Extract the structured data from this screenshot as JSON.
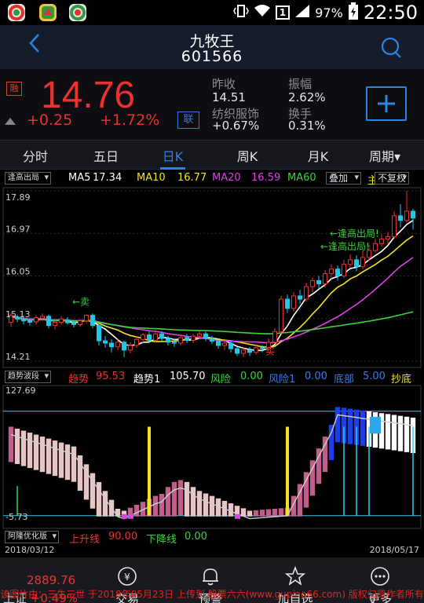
{
  "status_bar": {
    "battery": "97%",
    "time": "22:50",
    "sim": "1"
  },
  "header": {
    "stock_name": "九牧王",
    "stock_code": "601566"
  },
  "quote": {
    "margin_badge": "融",
    "price": "14.76",
    "change": "+0.25",
    "change_pct": "+1.72%",
    "link_badge": "联",
    "prev_close_label": "昨收",
    "prev_close": "14.51",
    "amplitude_label": "振幅",
    "amplitude": "2.62%",
    "sector": "纺织服饰",
    "sector_chg": "+0.67%",
    "turnover_label": "换手",
    "turnover": "0.31%"
  },
  "tabs": [
    "分时",
    "五日",
    "日K",
    "周K",
    "月K",
    "周期▾"
  ],
  "active_tab": 2,
  "kline_bar": {
    "dropdown": "逢高出局",
    "ma5_label": "MA5",
    "ma5": "17.34",
    "ma10_label": "MA10",
    "ma10": "16.77",
    "ma20_label": "MA20",
    "ma20": "16.59",
    "ma60_label": "MA60",
    "overlay_btn": "叠加",
    "adjust_btn": "不复权"
  },
  "osc_bar": {
    "dropdown": "趋势波段",
    "trend_label": "趋势",
    "trend": "95.53",
    "trend1_label": "趋势1",
    "trend1": "105.70",
    "risk_label": "风险",
    "risk": "0.00",
    "risk1_label": "风险1",
    "risk1": "0.00",
    "bottom_label": "底部",
    "bottom": "5.00",
    "catch_label": "抄底"
  },
  "lower_bar": {
    "dropdown": "阿隆优化版",
    "up_label": "上升线",
    "up": "90.00",
    "down_label": "下降线",
    "down": "0.00"
  },
  "dates": {
    "start": "2018/03/12",
    "end": "2018/05/17"
  },
  "bottom_nav": {
    "index_value": "2889.76",
    "index_change": "+0.49%",
    "index_prefix": "上证",
    "items": [
      "交易",
      "预警",
      "加自选",
      "更多"
    ]
  },
  "watermark": "该图片由：三生三世 于2018年05月23日 上传到 股票六六(www.gupiao66.com) 版权归原作者所有",
  "chart_data": [
    {
      "type": "candlestick",
      "title": "日K",
      "ylim": [
        14.21,
        17.89
      ],
      "ticks": [
        "17.89",
        "16.97",
        "16.05",
        "15.13",
        "14.21"
      ],
      "annotations": [
        "←卖",
        "←逢高出局!",
        "←逢高出局!",
        "买"
      ],
      "series": [
        {
          "name": "price",
          "values": [
            [
              15.05,
              15.2,
              14.95,
              15.25
            ],
            [
              15.15,
              15.12,
              15.05,
              15.22
            ],
            [
              15.12,
              15.08,
              15.0,
              15.2
            ],
            [
              15.1,
              15.05,
              14.98,
              15.15
            ],
            [
              15.06,
              15.15,
              15.0,
              15.2
            ],
            [
              15.14,
              15.18,
              15.08,
              15.24
            ],
            [
              15.18,
              14.98,
              14.92,
              15.22
            ],
            [
              14.98,
              15.05,
              14.9,
              15.1
            ],
            [
              15.05,
              15.12,
              15.0,
              15.18
            ],
            [
              15.1,
              15.04,
              15.0,
              15.16
            ],
            [
              15.04,
              15.0,
              14.94,
              15.1
            ],
            [
              15.0,
              15.08,
              14.95,
              15.12
            ],
            [
              15.08,
              15.2,
              15.03,
              15.22
            ],
            [
              15.2,
              14.98,
              14.92,
              15.24
            ],
            [
              14.98,
              14.65,
              14.55,
              15.0
            ],
            [
              14.65,
              14.6,
              14.5,
              14.75
            ],
            [
              14.6,
              14.52,
              14.4,
              14.68
            ],
            [
              14.52,
              14.62,
              14.45,
              14.7
            ],
            [
              14.62,
              14.45,
              14.3,
              14.66
            ],
            [
              14.45,
              14.55,
              14.38,
              14.62
            ],
            [
              14.55,
              14.68,
              14.5,
              14.75
            ],
            [
              14.68,
              14.78,
              14.6,
              14.82
            ],
            [
              14.78,
              14.66,
              14.6,
              14.85
            ],
            [
              14.66,
              14.8,
              14.62,
              14.88
            ],
            [
              14.8,
              14.7,
              14.64,
              14.86
            ],
            [
              14.7,
              14.62,
              14.55,
              14.76
            ],
            [
              14.62,
              14.6,
              14.52,
              14.7
            ],
            [
              14.6,
              14.72,
              14.55,
              14.78
            ],
            [
              14.72,
              14.66,
              14.6,
              14.8
            ],
            [
              14.66,
              14.75,
              14.6,
              14.8
            ],
            [
              14.75,
              14.8,
              14.7,
              14.86
            ],
            [
              14.8,
              14.7,
              14.64,
              14.85
            ],
            [
              14.7,
              14.64,
              14.58,
              14.76
            ],
            [
              14.64,
              14.55,
              14.48,
              14.7
            ],
            [
              14.55,
              14.6,
              14.45,
              14.66
            ],
            [
              14.6,
              14.48,
              14.4,
              14.64
            ],
            [
              14.48,
              14.38,
              14.32,
              14.52
            ],
            [
              14.38,
              14.45,
              14.3,
              14.5
            ],
            [
              14.45,
              14.4,
              14.32,
              14.52
            ],
            [
              14.4,
              14.5,
              14.35,
              14.58
            ],
            [
              14.5,
              14.48,
              14.4,
              14.56
            ],
            [
              14.48,
              14.62,
              14.44,
              14.7
            ],
            [
              14.62,
              14.85,
              14.58,
              14.92
            ],
            [
              14.85,
              15.55,
              14.8,
              15.62
            ],
            [
              15.55,
              15.35,
              15.25,
              15.65
            ],
            [
              15.35,
              15.62,
              15.28,
              15.7
            ],
            [
              15.62,
              15.55,
              15.45,
              15.75
            ],
            [
              15.55,
              15.82,
              15.5,
              15.9
            ],
            [
              15.82,
              15.95,
              15.7,
              16.02
            ],
            [
              15.95,
              15.88,
              15.78,
              16.05
            ],
            [
              15.88,
              16.1,
              15.8,
              16.18
            ],
            [
              16.1,
              16.2,
              16.0,
              16.3
            ],
            [
              16.2,
              16.05,
              15.95,
              16.28
            ],
            [
              16.05,
              16.3,
              16.0,
              16.4
            ],
            [
              16.3,
              16.4,
              16.22,
              16.52
            ],
            [
              16.4,
              16.25,
              16.15,
              16.5
            ],
            [
              16.25,
              16.45,
              16.2,
              16.6
            ],
            [
              16.45,
              16.6,
              16.38,
              16.72
            ],
            [
              16.6,
              16.75,
              16.55,
              16.85
            ],
            [
              16.75,
              16.85,
              16.68,
              16.95
            ],
            [
              16.85,
              16.9,
              16.75,
              17.0
            ],
            [
              16.9,
              17.35,
              16.85,
              17.45
            ],
            [
              17.35,
              17.25,
              17.1,
              17.6
            ],
            [
              17.25,
              17.45,
              17.2,
              17.89
            ],
            [
              17.45,
              17.3,
              17.05,
              17.5
            ]
          ]
        }
      ]
    },
    {
      "type": "bar",
      "title": "趋势波段",
      "ylim": [
        -5.73,
        127.69
      ],
      "ticks": [
        "127.69",
        "-5.73"
      ]
    },
    {
      "type": "line",
      "title": "阿隆优化版",
      "series": [
        {
          "name": "上升线",
          "values": [
            90.0
          ]
        },
        {
          "name": "下降线",
          "values": [
            0.0
          ]
        }
      ]
    }
  ]
}
